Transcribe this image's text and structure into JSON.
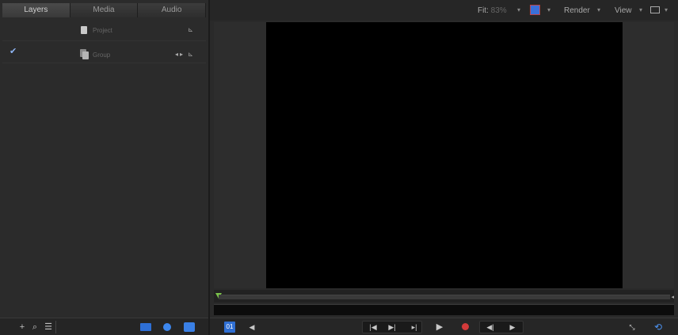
{
  "left_panel": {
    "tabs": [
      "Layers",
      "Media",
      "Audio"
    ],
    "active_tab": "Layers",
    "layers": [
      {
        "name": "Project",
        "checked": false,
        "icons": "⊾"
      },
      {
        "name": "Group",
        "checked": true,
        "icons": "◂▸ ⊾"
      }
    ],
    "bottom_toolbar": {
      "add_icon": "plus-icon",
      "search_icon": "search-icon",
      "list_icon": "list-icon"
    }
  },
  "viewer_toolbar": {
    "fit_label": "Fit:",
    "fit_value": "83%",
    "render_label": "Render",
    "view_label": "View",
    "arrow": "▾"
  },
  "transport": {
    "first": "|◀",
    "back": "▶|",
    "step": "▸|",
    "play": "▶",
    "rew": "◀|",
    "fwd": "▶",
    "prev": "◀",
    "loop": "⟲",
    "expand": "⤡"
  },
  "colors": {
    "accent": "#2f6fd4",
    "record": "#d23a3a",
    "playhead": "#7bc34a"
  }
}
